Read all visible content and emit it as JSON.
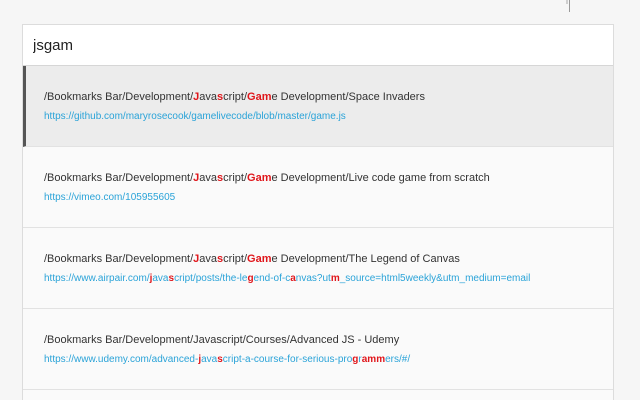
{
  "search": {
    "value": "jsgam"
  },
  "colors": {
    "highlight": "#e0161b",
    "link": "#2aa3d8",
    "selected_background": "#ececec"
  },
  "results": [
    {
      "path_segments": [
        {
          "t": "/Bookmarks Bar/Development/"
        },
        {
          "t": "J",
          "h": true
        },
        {
          "t": "ava"
        },
        {
          "t": "s",
          "h": true
        },
        {
          "t": "cript/"
        },
        {
          "t": "Gam",
          "h": true
        },
        {
          "t": "e Development/Space Invaders"
        }
      ],
      "url_segments": [
        {
          "t": "https://github.com/maryrosecook/gamelivecode/blob/master/game.js"
        }
      ],
      "selected": true
    },
    {
      "path_segments": [
        {
          "t": "/Bookmarks Bar/Development/"
        },
        {
          "t": "J",
          "h": true
        },
        {
          "t": "ava"
        },
        {
          "t": "s",
          "h": true
        },
        {
          "t": "cript/"
        },
        {
          "t": "Gam",
          "h": true
        },
        {
          "t": "e Development/Live code game from scratch"
        }
      ],
      "url_segments": [
        {
          "t": "https://vimeo.com/105955605"
        }
      ],
      "selected": false
    },
    {
      "path_segments": [
        {
          "t": "/Bookmarks Bar/Development/"
        },
        {
          "t": "J",
          "h": true
        },
        {
          "t": "ava"
        },
        {
          "t": "s",
          "h": true
        },
        {
          "t": "cript/"
        },
        {
          "t": "Gam",
          "h": true
        },
        {
          "t": "e Development/The Legend of Canvas"
        }
      ],
      "url_segments": [
        {
          "t": "https://www.airpair.com/"
        },
        {
          "t": "j",
          "h": true
        },
        {
          "t": "ava"
        },
        {
          "t": "s",
          "h": true
        },
        {
          "t": "cript/posts/the-le"
        },
        {
          "t": "g",
          "h": true
        },
        {
          "t": "end-of-c"
        },
        {
          "t": "a",
          "h": true
        },
        {
          "t": "nvas?ut"
        },
        {
          "t": "m",
          "h": true
        },
        {
          "t": "_source=html5weekly&utm_medium=email"
        }
      ],
      "selected": false
    },
    {
      "path_segments": [
        {
          "t": "/Bookmarks Bar/Development/Javascript/Courses/Advanced JS - Udemy"
        }
      ],
      "url_segments": [
        {
          "t": "https://www.udemy.com/advanced-"
        },
        {
          "t": "j",
          "h": true
        },
        {
          "t": "ava"
        },
        {
          "t": "s",
          "h": true
        },
        {
          "t": "cript-a-course-for-serious-pro"
        },
        {
          "t": "g",
          "h": true
        },
        {
          "t": "r"
        },
        {
          "t": "amm",
          "h": true
        },
        {
          "t": "ers/#/"
        }
      ],
      "selected": false
    }
  ]
}
